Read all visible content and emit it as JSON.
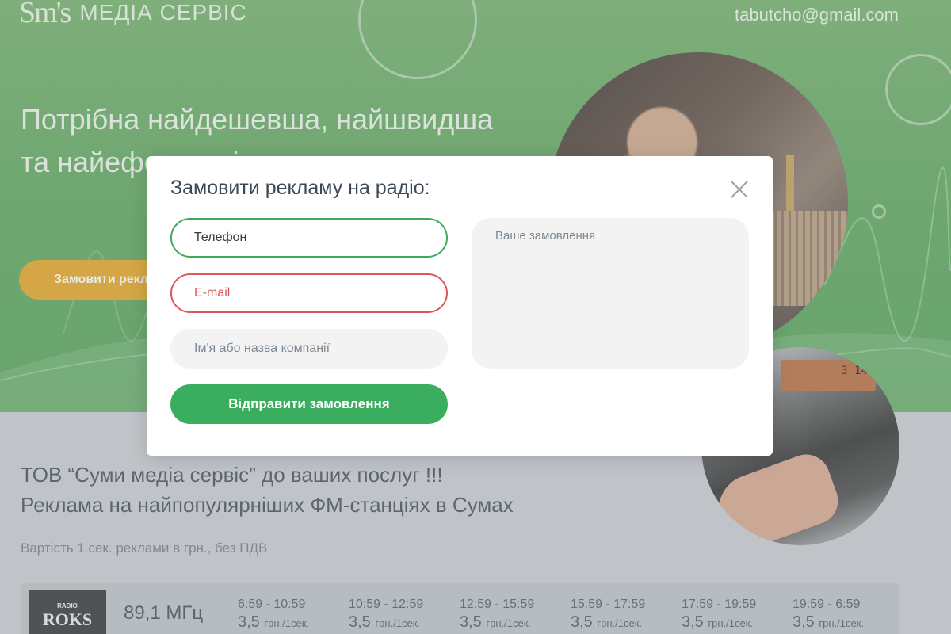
{
  "header": {
    "logo_mark": "Sm's",
    "logo_text": "МЕДІА СЕРВІС",
    "email": "tabutcho@gmail.com"
  },
  "hero": {
    "title": "Потрібна найдешевша, найшвидша та найефективніша реклама",
    "cta_label": "Замовити рекламу"
  },
  "photo2": {
    "display_readout": "3 14"
  },
  "lower": {
    "title_line1": "ТОВ  “Суми медіа сервіс” до ваших послуг !!!",
    "title_line2": "Реклама на найпопулярніших ФМ-станціях в Сумах",
    "price_note": "Вартість 1 сек. реклами в грн.,  без ПДВ"
  },
  "stations": [
    {
      "logo_top": "RADIO",
      "logo_name": "ROKS",
      "frequency": "89,1 МГц",
      "slots": [
        {
          "time": "6:59 - 10:59",
          "price": "3,5",
          "unit": "грн./1сек."
        },
        {
          "time": "10:59 - 12:59",
          "price": "3,5",
          "unit": "грн./1сек."
        },
        {
          "time": "12:59 - 15:59",
          "price": "3,5",
          "unit": "грн./1сек."
        },
        {
          "time": "15:59 - 17:59",
          "price": "3,5",
          "unit": "грн./1сек."
        },
        {
          "time": "17:59 - 19:59",
          "price": "3,5",
          "unit": "грн./1сек."
        },
        {
          "time": "19:59 - 6:59",
          "price": "3,5",
          "unit": "грн./1сек."
        }
      ]
    }
  ],
  "modal": {
    "title": "Замовити рекламу на радіо:",
    "phone_placeholder": "Телефон",
    "email_placeholder": "E-mail",
    "name_placeholder": "Ім'я або назва компанії",
    "order_placeholder": "Ваше замовлення",
    "submit_label": "Відправити замовлення"
  },
  "colors": {
    "hero_green": "#5aa457",
    "accent_orange": "#e6a21c",
    "button_green": "#3aad5f",
    "error_red": "#e05656",
    "valid_green": "#3fa95d"
  },
  "icons": {
    "modal_close": "close-icon"
  }
}
